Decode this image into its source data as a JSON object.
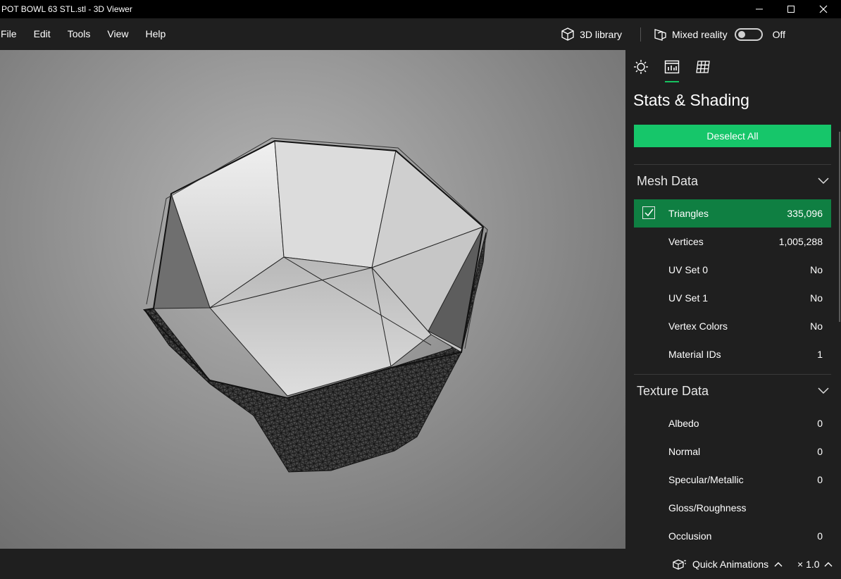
{
  "window": {
    "title": "POT BOWL 63 STL.stl - 3D Viewer"
  },
  "menu": {
    "items": [
      "File",
      "Edit",
      "Tools",
      "View",
      "Help"
    ],
    "library_label": "3D library",
    "mixed_reality_label": "Mixed reality",
    "toggle_state": "Off"
  },
  "panel": {
    "title": "Stats & Shading",
    "deselect_label": "Deselect All",
    "mesh_section": "Mesh Data",
    "mesh_rows": [
      {
        "label": "Triangles",
        "value": "335,096",
        "selected": true
      },
      {
        "label": "Vertices",
        "value": "1,005,288"
      },
      {
        "label": "UV Set 0",
        "value": "No"
      },
      {
        "label": "UV Set 1",
        "value": "No"
      },
      {
        "label": "Vertex Colors",
        "value": "No"
      },
      {
        "label": "Material IDs",
        "value": "1"
      }
    ],
    "texture_section": "Texture Data",
    "texture_rows": [
      {
        "label": "Albedo",
        "value": "0"
      },
      {
        "label": "Normal",
        "value": "0"
      },
      {
        "label": "Specular/Metallic",
        "value": "0"
      },
      {
        "label": "Gloss/Roughness",
        "value": ""
      },
      {
        "label": "Occlusion",
        "value": "0"
      }
    ],
    "tabs": [
      "sun-icon",
      "stats-icon",
      "grid-icon"
    ],
    "accent": "#16c66a"
  },
  "status": {
    "quick_animations": "Quick Animations",
    "speed": "× 1.0"
  }
}
